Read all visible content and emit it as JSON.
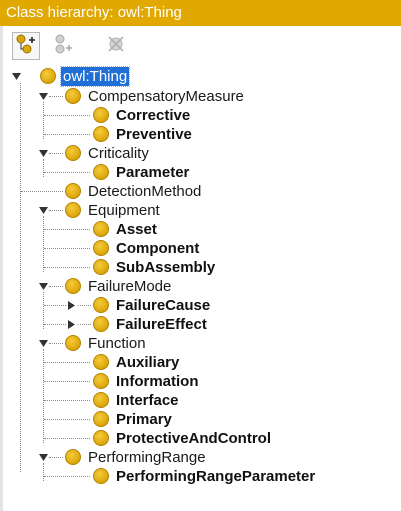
{
  "window": {
    "title": "Class hierarchy: owl:Thing"
  },
  "toolbar": {
    "buttons": [
      {
        "name": "add-subclass-button",
        "icon": "add-subclass-icon",
        "enabled": true
      },
      {
        "name": "add-sibling-class-button",
        "icon": "add-sibling-class-icon",
        "enabled": false
      },
      {
        "name": "delete-class-button",
        "icon": "delete-class-icon",
        "enabled": false
      }
    ]
  },
  "tree": {
    "root": {
      "label": "owl:Thing",
      "selected": true,
      "expanded": true
    },
    "groups": [
      {
        "label": "CompensatoryMeasure",
        "expanded": true,
        "children": [
          {
            "label": "Corrective"
          },
          {
            "label": "Preventive"
          }
        ]
      },
      {
        "label": "Criticality",
        "expanded": true,
        "children": [
          {
            "label": "Parameter"
          }
        ]
      },
      {
        "label": "DetectionMethod",
        "expanded": false,
        "children": []
      },
      {
        "label": "Equipment",
        "expanded": true,
        "children": [
          {
            "label": "Asset"
          },
          {
            "label": "Component"
          },
          {
            "label": "SubAssembly"
          }
        ]
      },
      {
        "label": "FailureMode",
        "expanded": true,
        "children": [
          {
            "label": "FailureCause",
            "collapsed_toggle": true
          },
          {
            "label": "FailureEffect",
            "collapsed_toggle": true
          }
        ]
      },
      {
        "label": "Function",
        "expanded": true,
        "children": [
          {
            "label": "Auxiliary"
          },
          {
            "label": "Information"
          },
          {
            "label": "Interface"
          },
          {
            "label": "Primary"
          },
          {
            "label": "ProtectiveAndControl"
          }
        ]
      },
      {
        "label": "PerformingRange",
        "expanded": true,
        "children": [
          {
            "label": "PerformingRangeParameter"
          }
        ]
      }
    ]
  },
  "colors": {
    "titlebar": "#e0a800",
    "class_dot": "#dca60a",
    "selection": "#1f6fd6"
  }
}
